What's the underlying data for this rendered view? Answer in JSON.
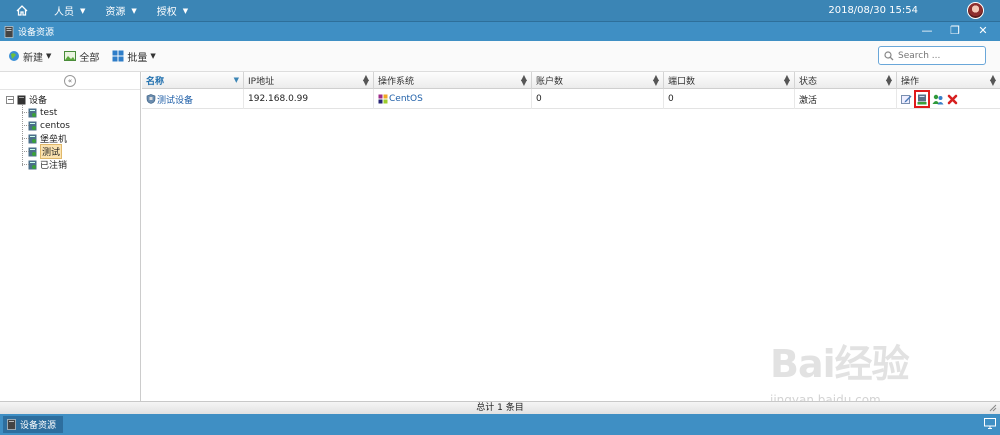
{
  "topnav": {
    "menus": [
      {
        "label": "人员"
      },
      {
        "label": "资源"
      },
      {
        "label": "授权"
      }
    ],
    "datetime": "2018/08/30 15:54"
  },
  "window": {
    "title": "设备资源"
  },
  "toolbar": {
    "new_label": "新建",
    "all_label": "全部",
    "batch_label": "批量",
    "search_placeholder": "Search ..."
  },
  "tree": {
    "root": "设备",
    "children": [
      {
        "label": "test"
      },
      {
        "label": "centos"
      },
      {
        "label": "堡垒机"
      },
      {
        "label": "测试",
        "selected": true
      },
      {
        "label": "已注销"
      }
    ]
  },
  "grid": {
    "columns": [
      {
        "label": "名称"
      },
      {
        "label": "IP地址"
      },
      {
        "label": "操作系统"
      },
      {
        "label": "账户数"
      },
      {
        "label": "端口数"
      },
      {
        "label": "状态"
      },
      {
        "label": "操作"
      }
    ],
    "rows": [
      {
        "name": "测试设备",
        "ip": "192.168.0.99",
        "os": "CentOS",
        "accounts": "0",
        "ports": "0",
        "status": "激活"
      }
    ]
  },
  "footer": {
    "summary": "总计 1 条目"
  },
  "taskbar": {
    "task_label": "设备资源"
  },
  "watermark": {
    "brand": "Bai经验",
    "url": "jingyan.baidu.com"
  },
  "colors": {
    "header_blue": "#3b85b5",
    "link_blue": "#1f5fa8",
    "highlight_red": "#e01b1b"
  }
}
